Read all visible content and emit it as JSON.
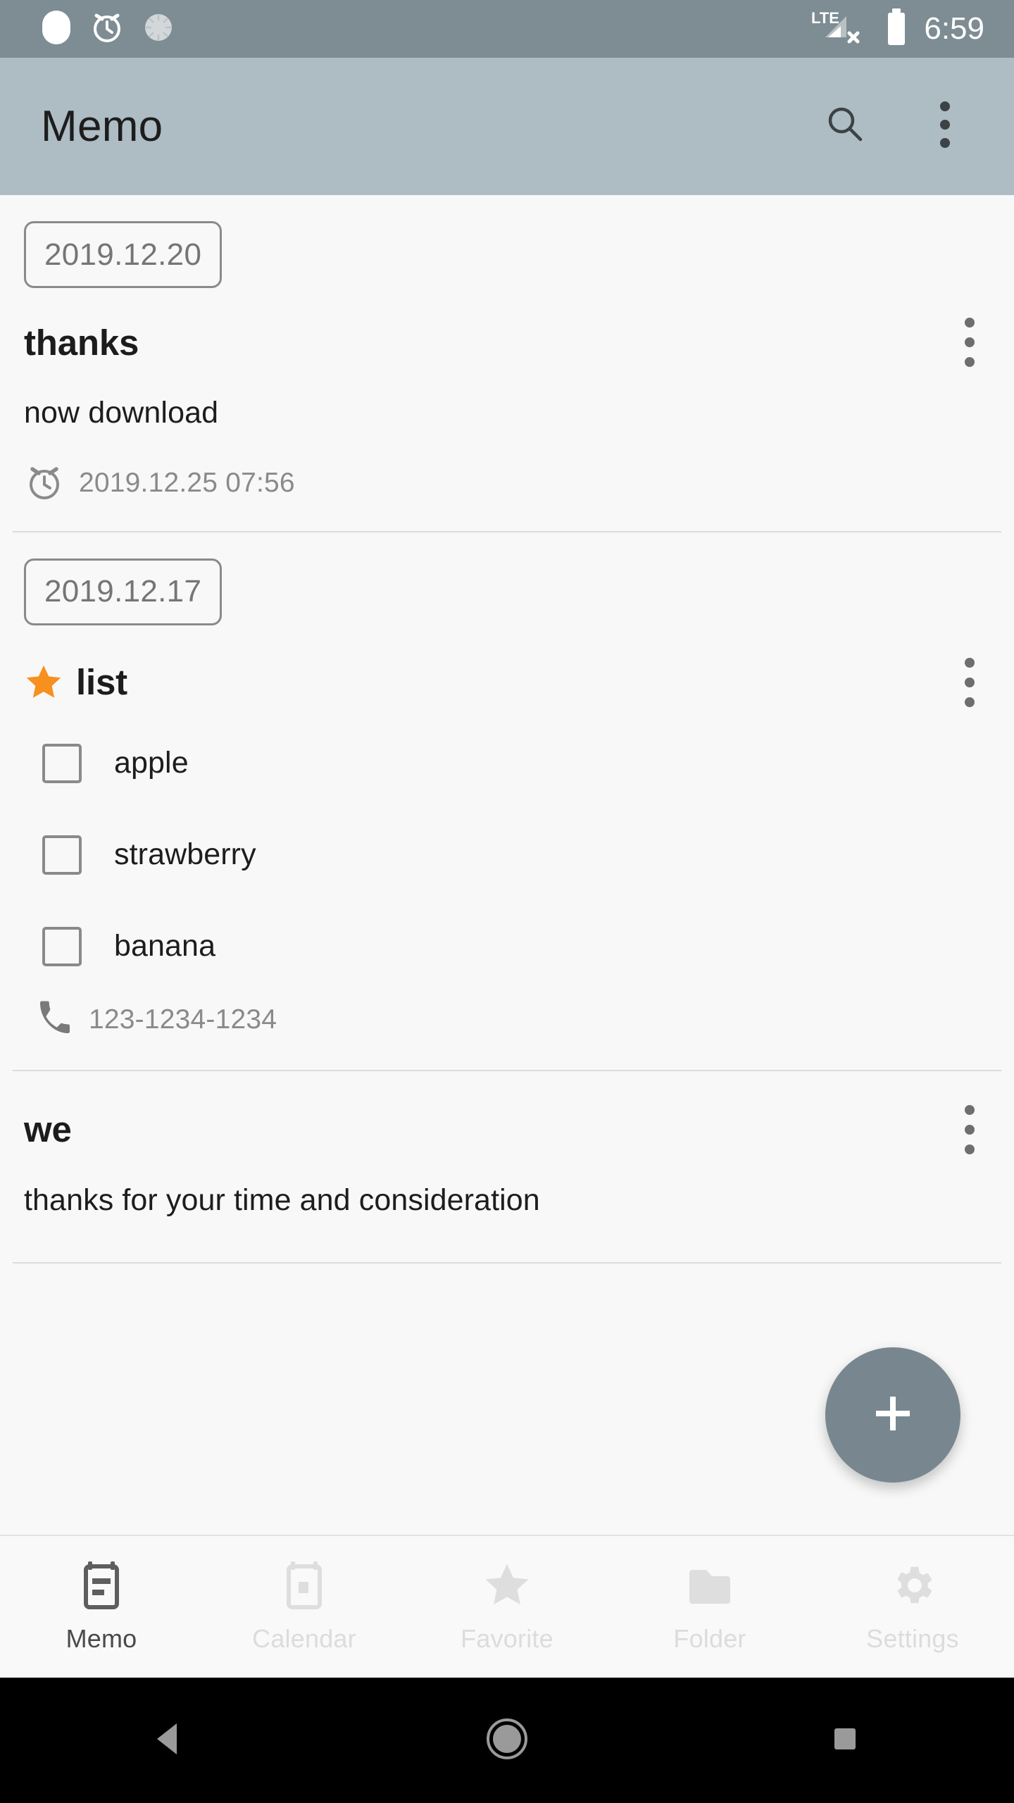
{
  "status_bar": {
    "left_icons": [
      "capsule-indicator-icon",
      "alarm-icon",
      "sync-spinner-icon"
    ],
    "network_label": "LTE",
    "network_state": "no-data",
    "battery": "full",
    "time": "6:59",
    "background": "#7e8c93"
  },
  "app_bar": {
    "title": "Memo",
    "background": "#aebcc4",
    "search_icon": "search-icon",
    "overflow_icon": "overflow-menu-icon"
  },
  "groups": [
    {
      "date": "2019.12.20",
      "memos": [
        {
          "title": "thanks",
          "starred": false,
          "body": "now download",
          "alarm": "2019.12.25 07:56",
          "checklist": [],
          "phone": null
        }
      ]
    },
    {
      "date": "2019.12.17",
      "memos": [
        {
          "title": "list",
          "starred": true,
          "body": null,
          "alarm": null,
          "checklist": [
            {
              "label": "apple",
              "checked": false
            },
            {
              "label": "strawberry",
              "checked": false
            },
            {
              "label": "banana",
              "checked": false
            }
          ],
          "phone": "123-1234-1234"
        },
        {
          "title": "we",
          "starred": false,
          "body": "thanks for your time and consideration",
          "alarm": null,
          "checklist": [],
          "phone": null
        }
      ]
    }
  ],
  "fab": {
    "icon": "plus-icon",
    "label": "",
    "color": "#78878f"
  },
  "bottom_nav": {
    "active_index": 0,
    "items": [
      {
        "label": "Memo",
        "icon": "memo-icon"
      },
      {
        "label": "Calendar",
        "icon": "calendar-icon"
      },
      {
        "label": "Favorite",
        "icon": "star-icon"
      },
      {
        "label": "Folder",
        "icon": "folder-icon"
      },
      {
        "label": "Settings",
        "icon": "gear-icon"
      }
    ]
  },
  "android_nav": {
    "back": "back-triangle-icon",
    "home": "home-circle-icon",
    "recents": "recents-square-icon"
  },
  "colors": {
    "accent_star": "#f7901e",
    "text_primary": "#1d1d1d",
    "text_secondary": "#8a8a8a",
    "background": "#f8f8f8",
    "divider": "#dcdcdc"
  }
}
